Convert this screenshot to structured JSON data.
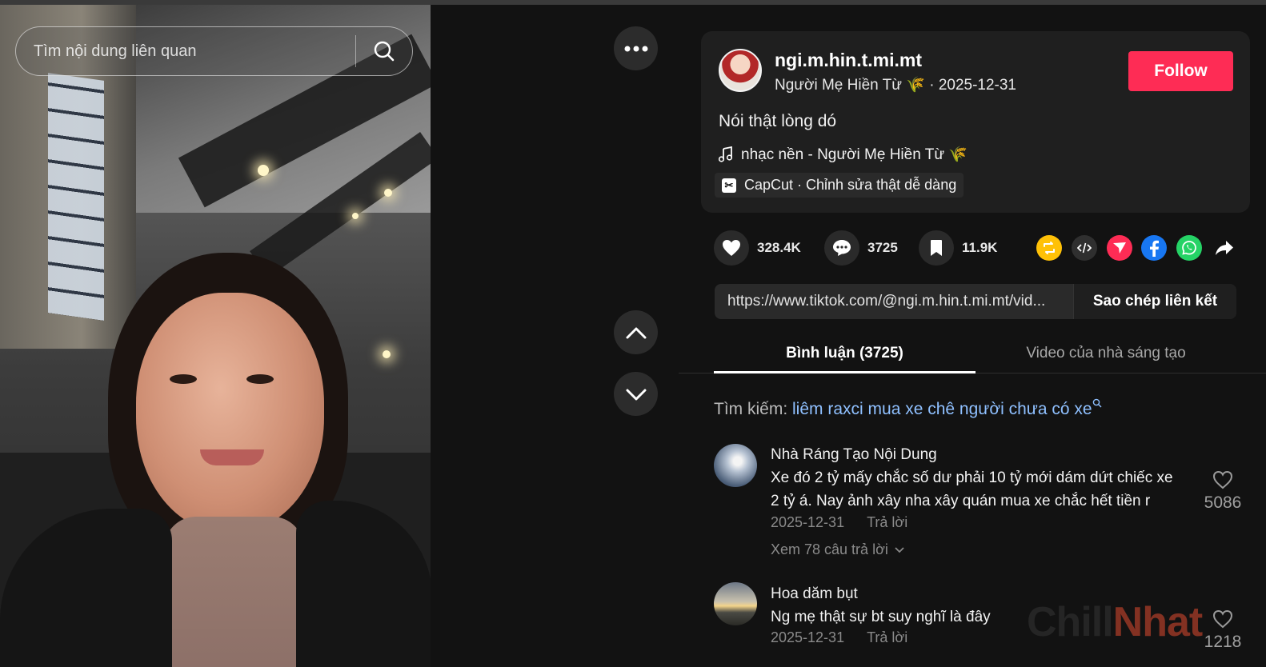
{
  "search": {
    "placeholder": "Tìm nội dung liên quan"
  },
  "video": {
    "more_icon": "ellipsis-icon",
    "up_icon": "chevron-up-icon",
    "down_icon": "chevron-down-icon"
  },
  "author": {
    "username": "ngi.m.hin.t.mi.mt",
    "display_name": "Người Mẹ Hiền Từ 🌾",
    "date": "2025-12-31",
    "follow_label": "Follow"
  },
  "post": {
    "caption": "Nói thật lòng dó",
    "music": "nhạc nền - Người Mẹ Hiền Từ 🌾",
    "capcut_label": "CapCut · Chỉnh sửa thật dễ dàng"
  },
  "stats": {
    "likes": "328.4K",
    "comments": "3725",
    "saves": "11.9K"
  },
  "share": {
    "icons": [
      "repost-icon",
      "embed-icon",
      "send-icon",
      "facebook-icon",
      "whatsapp-icon",
      "share-arrow-icon"
    ]
  },
  "link": {
    "url": "https://www.tiktok.com/@ngi.m.hin.t.mi.mt/vid...",
    "copy_label": "Sao chép liên kết"
  },
  "tabs": [
    {
      "label": "Bình luận (3725)",
      "active": true
    },
    {
      "label": "Video của nhà sáng tạo",
      "active": false
    }
  ],
  "related_search": {
    "prefix": "Tìm kiếm:",
    "keyword": "liêm raxci mua xe chê người chưa có xe"
  },
  "comments": [
    {
      "name": "Nhà Ráng Tạo Nội Dung",
      "text_line1": "Xe đó 2 tỷ mấy chắc số dư phải 10 tỷ mới dám dứt chiếc xe",
      "text_line2": "2 tỷ á. Nay ảnh xây nha xây quán mua xe chắc hết tiền r",
      "date": "2025-12-31",
      "reply_label": "Trả lời",
      "likes": "5086",
      "view_replies": "Xem 78 câu trả lời"
    },
    {
      "name": "Hoa dăm bụt",
      "text_line1": "Ng mẹ thật sự bt suy nghĩ là đây",
      "date": "2025-12-31",
      "reply_label": "Trả lời",
      "likes": "1218"
    }
  ],
  "watermark": {
    "part1": "Chill",
    "part2": "Nhat"
  },
  "colors": {
    "follow": "#fe2c55",
    "keyword": "#8fc0ff",
    "background": "#121212"
  }
}
